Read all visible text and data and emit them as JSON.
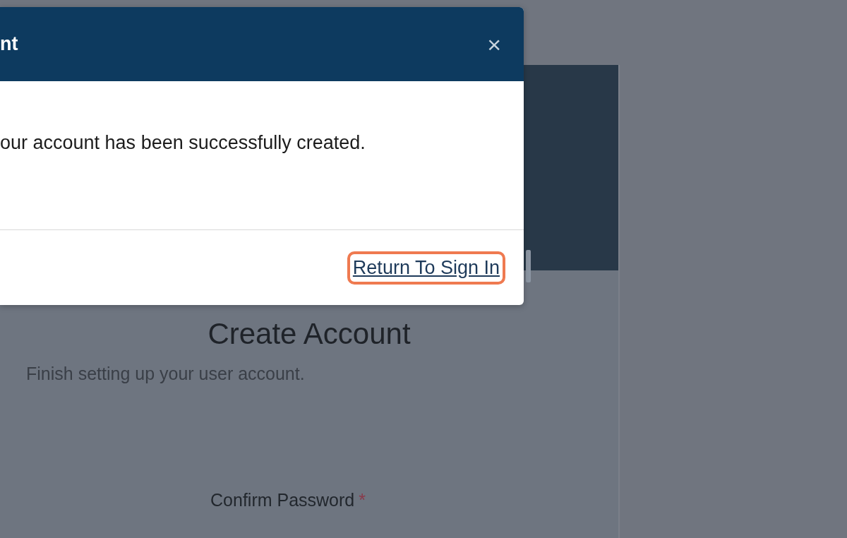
{
  "background_page": {
    "heading": "Create Account",
    "subtitle": "Finish setting up your user account.",
    "field_label": "Confirm Password",
    "required_mark": "*"
  },
  "modal": {
    "title": "nt",
    "close": "×",
    "message": "our account has been successfully created.",
    "link": {
      "label": "Return To Sign In",
      "highlighted": true
    }
  }
}
